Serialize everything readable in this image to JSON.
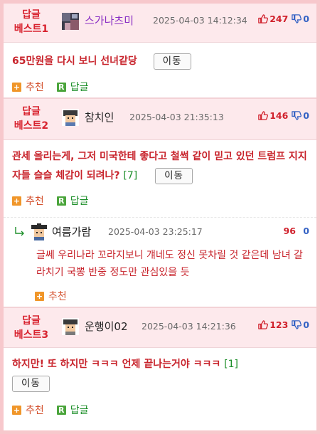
{
  "colors": {
    "page_border": "#f7c8cc",
    "best_label": "#d8232f",
    "comment_text": "#c8242c",
    "reply_count": "#1d8f2a",
    "upvote": "#d0212c",
    "downvote": "#3462c4"
  },
  "icons": {
    "thumbs_up": "thumbs-up-icon",
    "thumbs_down": "thumbs-down-icon",
    "recommend": "plus-square-icon",
    "reply": "r-square-icon",
    "reply_arrow": "reply-arrow-icon"
  },
  "labels": {
    "move": "이동",
    "recommend": "추천",
    "reply": "답글",
    "plus_glyph": "+",
    "r_glyph": "R"
  },
  "best_replies": [
    {
      "label_top": "답글",
      "label_bottom": "베스트1",
      "nickname": "스가나츠미",
      "timestamp": "2025-04-03 14:12:34",
      "upvotes": "247",
      "downvotes": "0",
      "text": "65만원을 다시 보니 선녀같당",
      "reply_count": ""
    },
    {
      "label_top": "답글",
      "label_bottom": "베스트2",
      "nickname": "참치인",
      "timestamp": "2025-04-03 21:35:13",
      "upvotes": "146",
      "downvotes": "0",
      "text": "관세 올리는게, 그저 미국한테 좋다고 철썩 같이 믿고 있던 트럼프 지지자들 슬슬 체감이 되려나?",
      "reply_count": "[7]",
      "sub_reply": {
        "nickname": "여름가람",
        "timestamp": "2025-04-03 23:25:17",
        "upvotes": "96",
        "downvotes": "0",
        "text": "글쎄 우리나라 꼬라지보니 걔네도 정신 못차릴 것 같은데 남녀 갈라치기 국뽕 반중 정도만 관심있을 듯"
      }
    },
    {
      "label_top": "답글",
      "label_bottom": "베스트3",
      "nickname": "운행이02",
      "timestamp": "2025-04-03 14:21:36",
      "upvotes": "123",
      "downvotes": "0",
      "text": "하지만! 또 하지만 ㅋㅋㅋ 언제 끝나는거야 ㅋㅋㅋ",
      "reply_count": "[1]"
    }
  ]
}
